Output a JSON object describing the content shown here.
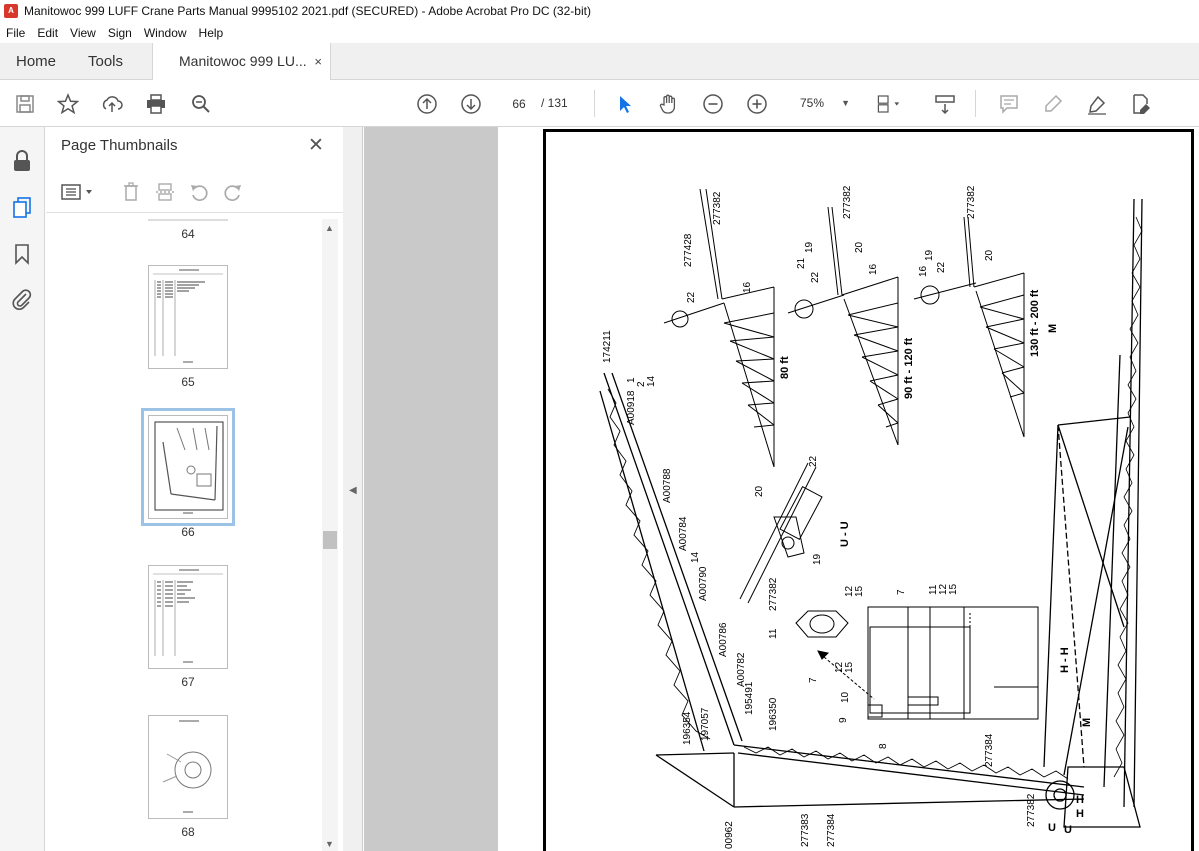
{
  "window": {
    "title": "Manitowoc 999 LUFF Crane Parts Manual 9995102 2021.pdf (SECURED) - Adobe Acrobat Pro DC (32-bit)"
  },
  "menu": [
    "File",
    "Edit",
    "View",
    "Sign",
    "Window",
    "Help"
  ],
  "tabs": {
    "home": "Home",
    "tools": "Tools",
    "doc": "Manitowoc 999 LU...",
    "close": "×"
  },
  "toolbar": {
    "page_current": "66",
    "page_total": "/ 131",
    "zoom": "75%"
  },
  "panel": {
    "title": "Page Thumbnails",
    "close": "✕",
    "thumbnails": [
      {
        "num": "64"
      },
      {
        "num": "65"
      },
      {
        "num": "66",
        "selected": true
      },
      {
        "num": "67"
      },
      {
        "num": "68"
      }
    ]
  },
  "drawing": {
    "labels": {
      "l1": "277382",
      "l2": "277428",
      "l3": "22",
      "l4": "16",
      "l5": "80 ft",
      "l6": "277382",
      "l7": "19",
      "l8": "20",
      "l9": "21",
      "l10": "22",
      "l11": "16",
      "l12": "90 ft - 120 ft",
      "l13": "277382",
      "l14": "19",
      "l15": "20",
      "l16": "16",
      "l17": "22",
      "l18": "130 ft - 200 ft",
      "l19": "M",
      "l20": "174211",
      "l21": "1",
      "l22": "2",
      "l23": "14",
      "l24": "A00918",
      "l25": "A00788",
      "l26": "A00784",
      "l27": "14",
      "l28": "A00790",
      "l29": "A00786",
      "l30": "A00782",
      "l31": "195491",
      "l32": "196350",
      "l33": "196354",
      "l34": "197057",
      "l35": "22",
      "l36": "20",
      "l37": "19",
      "l38": "277382",
      "l39": "U - U",
      "l40": "12",
      "l41": "15",
      "l42": "11",
      "l43": "7",
      "l44": "12",
      "l45": "15",
      "l46": "10",
      "l47": "9",
      "l48": "8",
      "l49": "7",
      "l50": "11",
      "l51": "12",
      "l52": "15",
      "l53": "H - H",
      "l54": "277384",
      "l55": "M",
      "l56": "277382",
      "l57": "U",
      "l58": "U",
      "l59": "H",
      "l60": "H",
      "l61": "00962",
      "l62": "277383",
      "l63": "277384"
    }
  }
}
